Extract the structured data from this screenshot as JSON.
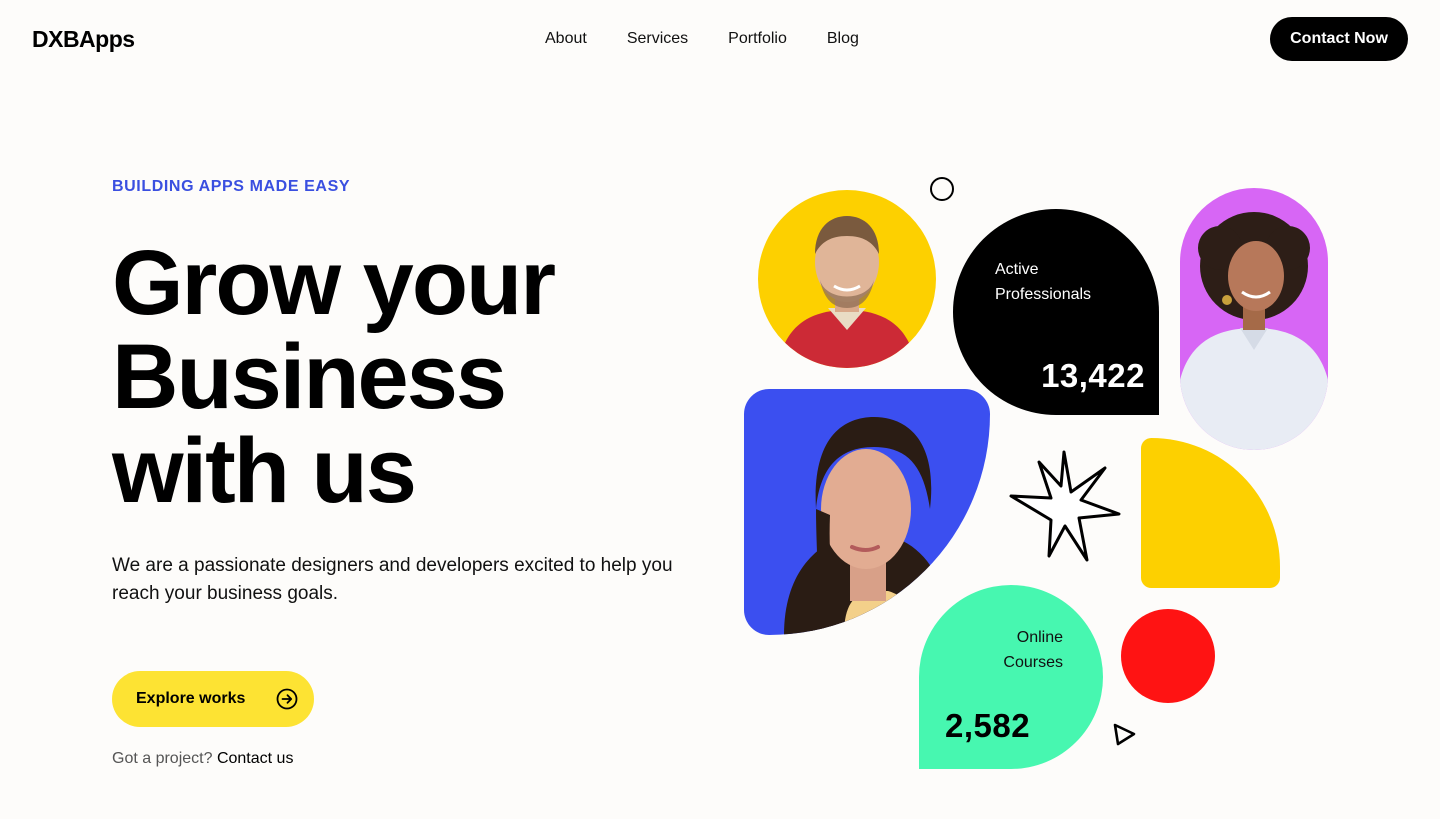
{
  "nav": {
    "logo": "DXBApps",
    "links": [
      "About",
      "Services",
      "Portfolio",
      "Blog"
    ],
    "cta": "Contact Now"
  },
  "hero": {
    "eyebrow": "BUILDING APPS MADE EASY",
    "headline": [
      "Grow your",
      "Business",
      "with us"
    ],
    "subtitle": "We are a passionate designers and developers excited to help you reach your business goals.",
    "primary_button": "Explore works",
    "project_prompt": "Got a project?",
    "project_link": "Contact us"
  },
  "stats": {
    "active": {
      "label": "Active Professionals",
      "value": "13,422"
    },
    "online": {
      "label_line1": "Online",
      "label_line2": "Courses",
      "value": "2,582"
    }
  },
  "colors": {
    "accent_blue": "#3a4fe0",
    "yellow": "#fdd000",
    "button_yellow": "#fde333",
    "purple": "#d766f5",
    "blue_tile": "#3b4ff0",
    "mint": "#47f7b0",
    "red": "#ff1313"
  },
  "icons": [
    "arrow-right-circle-icon",
    "sparkle-star-icon",
    "ring-icon",
    "triangle-pointer-icon"
  ]
}
